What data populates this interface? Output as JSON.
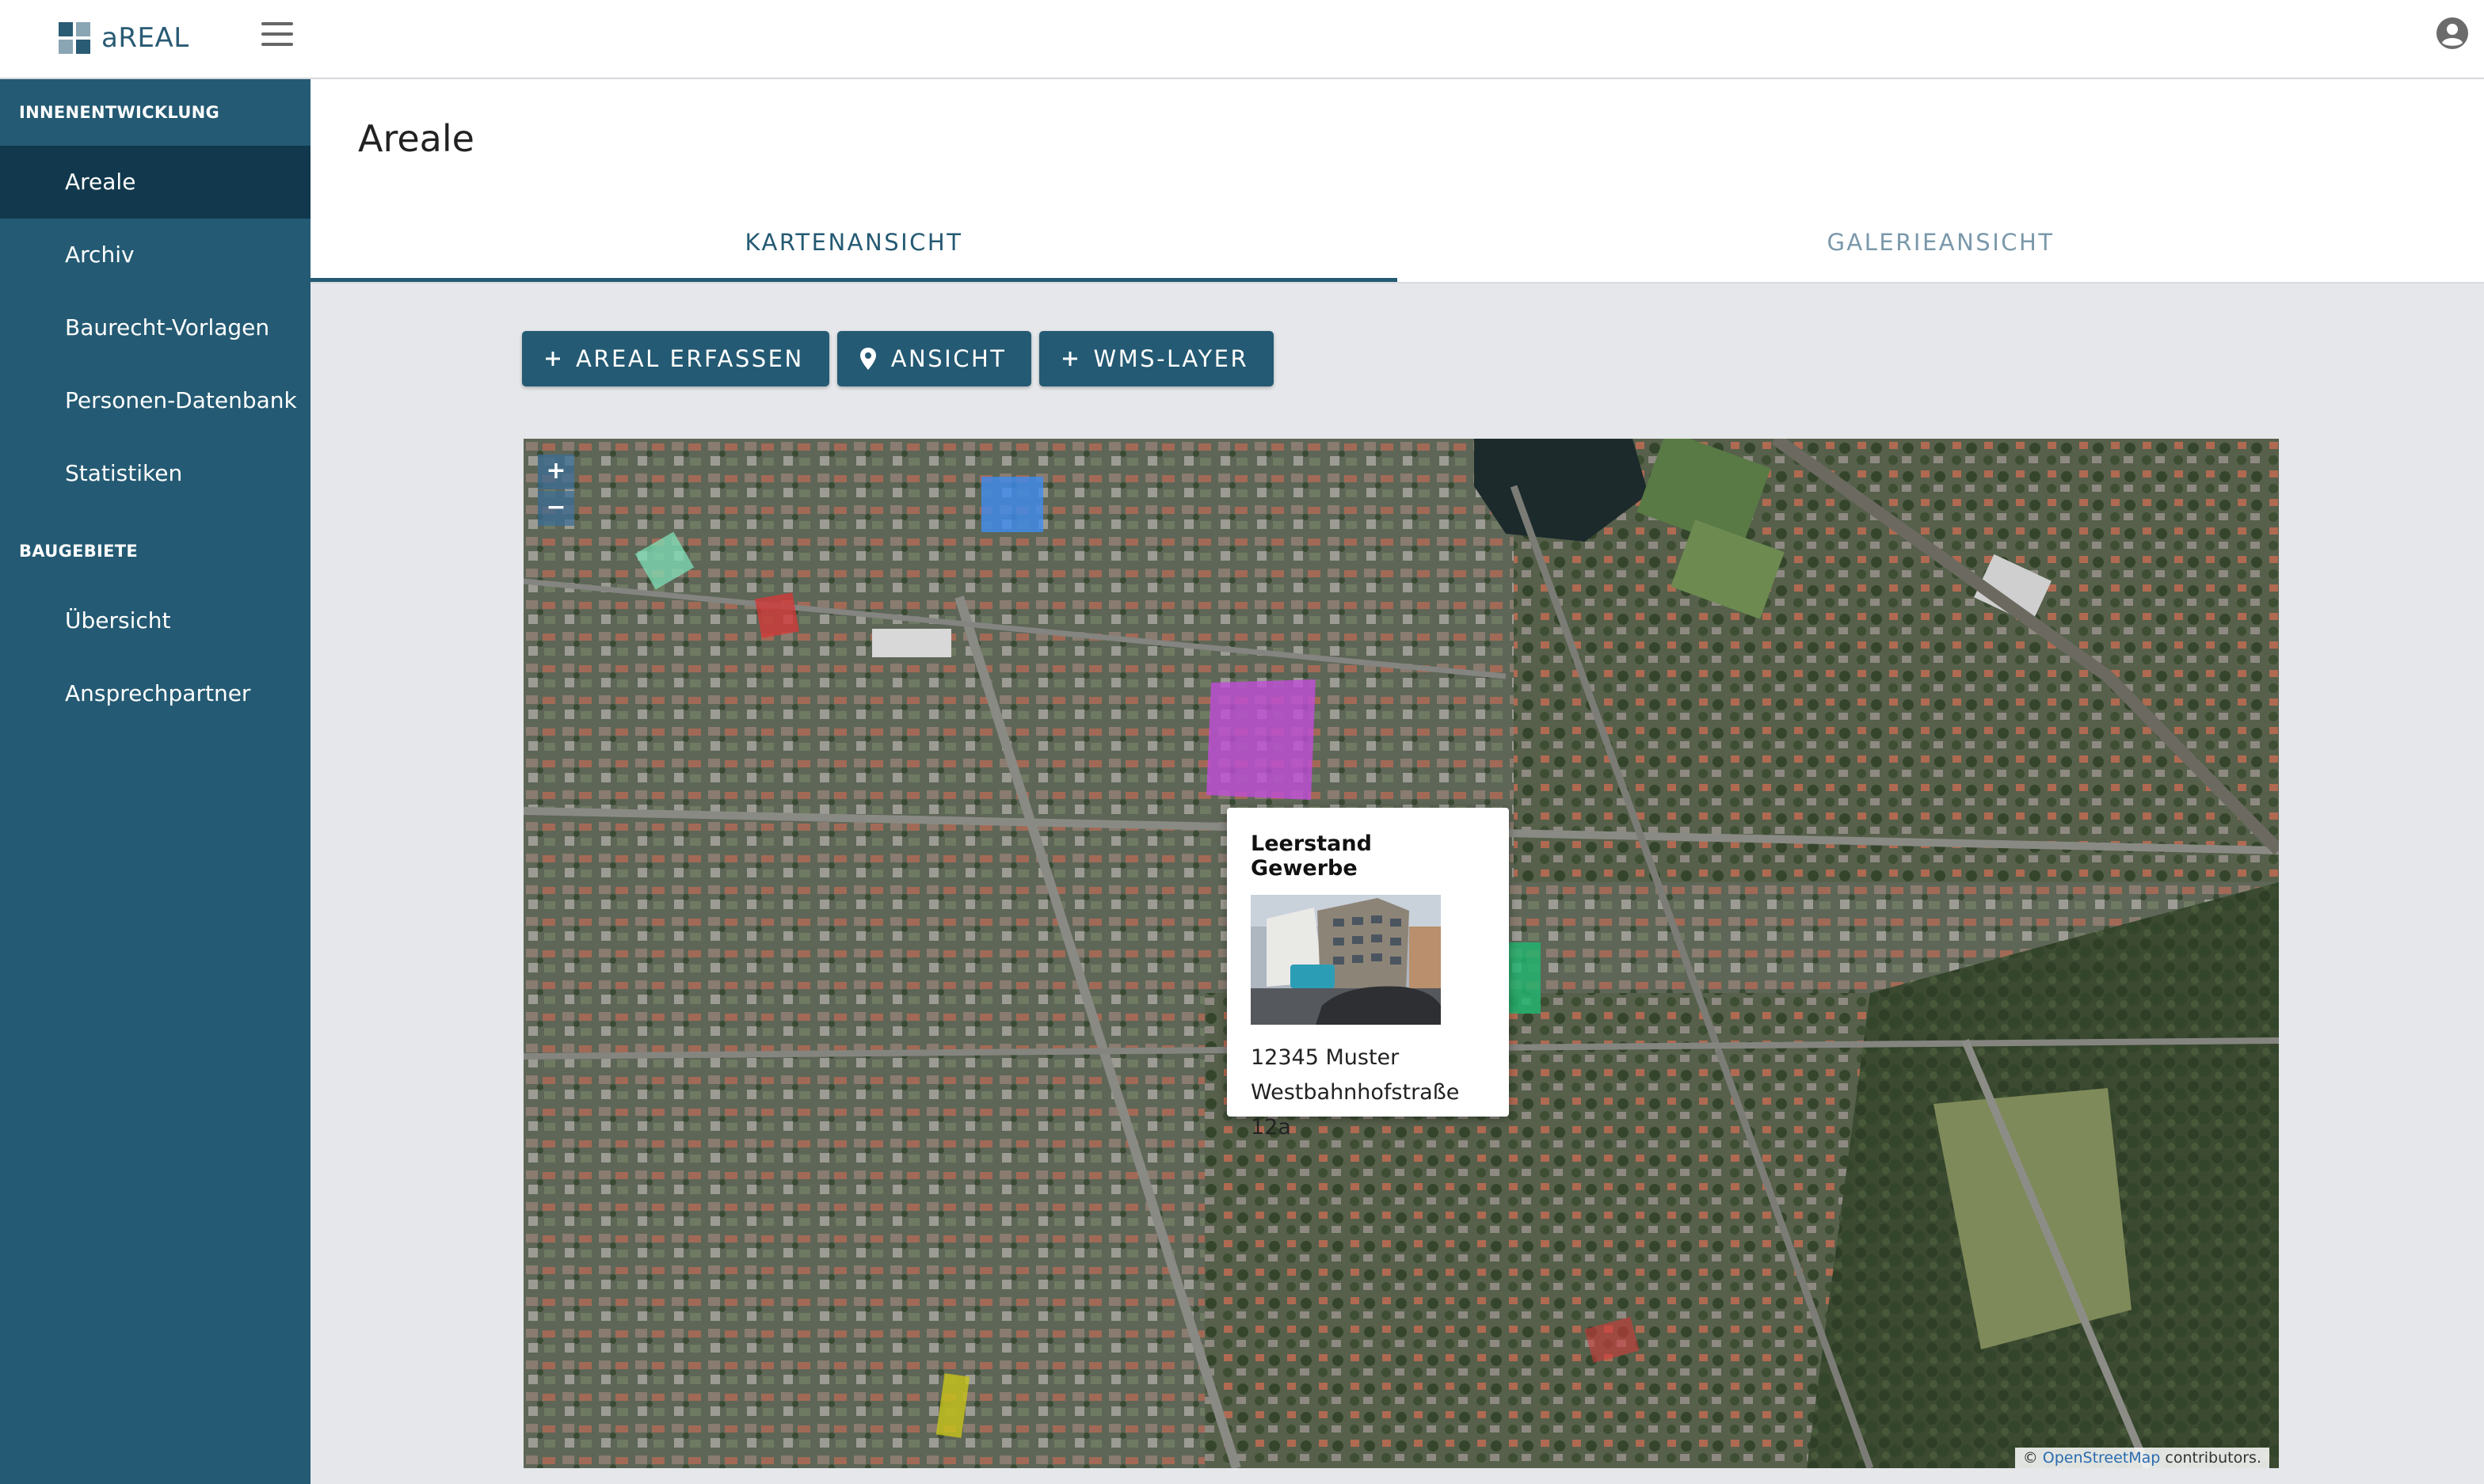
{
  "app": {
    "name": "aREAL"
  },
  "sidebar": {
    "sections": [
      {
        "title": "INNENENTWICKLUNG",
        "items": [
          {
            "label": "Areale",
            "active": true
          },
          {
            "label": "Archiv"
          },
          {
            "label": "Baurecht-Vorlagen"
          },
          {
            "label": "Personen-Datenbank"
          },
          {
            "label": "Statistiken"
          }
        ]
      },
      {
        "title": "BAUGEBIETE",
        "items": [
          {
            "label": "Übersicht"
          },
          {
            "label": "Ansprechpartner"
          }
        ]
      }
    ]
  },
  "page": {
    "title": "Areale"
  },
  "tabs": [
    {
      "label": "KARTENANSICHT",
      "active": true
    },
    {
      "label": "GALERIEANSICHT",
      "active": false
    }
  ],
  "toolbar": {
    "add_area": "AREAL ERFASSEN",
    "view": "ANSICHT",
    "wms_layer": "WMS-LAYER"
  },
  "map": {
    "zoom_in": "+",
    "zoom_out": "−",
    "attribution_prefix": "©",
    "attribution_link": "OpenStreetMap",
    "attribution_suffix": "contributors.",
    "popup": {
      "title": "Leerstand Gewerbe",
      "address_line1": "12345 Muster",
      "address_line2": "Westbahnhofstraße 12a"
    }
  },
  "colors": {
    "primary": "#245a73",
    "primary_dark": "#11384c",
    "area_blue": "#3f8cf0",
    "area_purple": "#c04ed8",
    "area_red": "#d23a3a",
    "area_green": "#1fb870",
    "area_yellow": "#c8c41a",
    "area_mint": "#7ee0b8"
  }
}
